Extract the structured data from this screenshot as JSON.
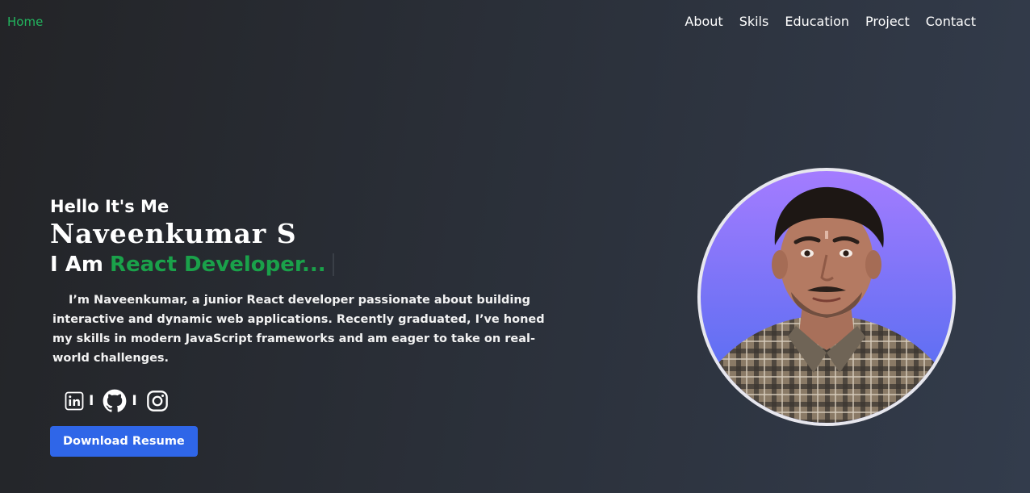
{
  "nav": {
    "home": "Home",
    "links": [
      "About",
      "Skils",
      "Education",
      "Project",
      "Contact"
    ]
  },
  "hero": {
    "greeting": "Hello It's Me",
    "name": "Naveenkumar S",
    "role_prefix": "I Am",
    "role_highlight": "React Developer...",
    "bio": "I’m Naveenkumar, a junior React developer passionate about building interactive and dynamic web applications. Recently graduated, I’ve honed my skills in modern JavaScript frameworks and am eager to take on real-world challenges.",
    "separator": "I",
    "button_label": "Download Resume"
  },
  "socials": [
    "linkedin-icon",
    "github-icon",
    "instagram-icon"
  ],
  "colors": {
    "accent": "#1aa14a",
    "nav_home": "#22b55e",
    "button": "#2f66e8"
  }
}
